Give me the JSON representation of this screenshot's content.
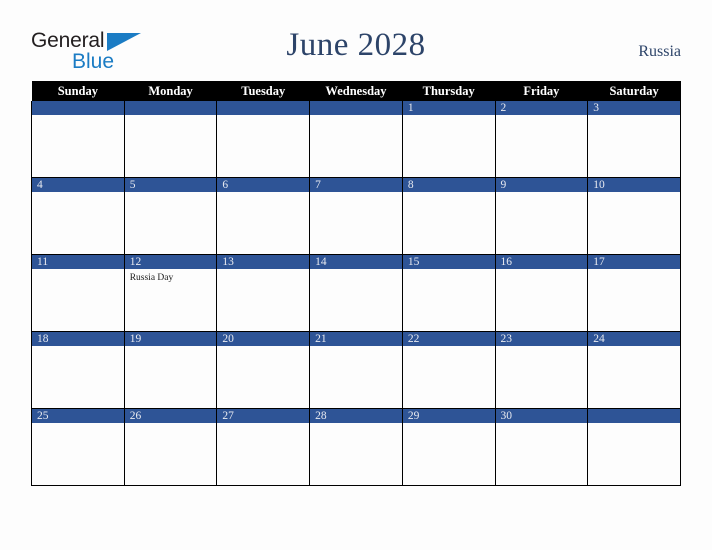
{
  "brand": {
    "name_part1": "General",
    "name_part2": "Blue",
    "triangle_icon": "triangle-icon",
    "color_dark": "#231f20",
    "color_blue": "#1b7cc4"
  },
  "header": {
    "title": "June 2028",
    "country": "Russia",
    "title_color": "#2d4469"
  },
  "theme": {
    "accent_blue": "#2e5496",
    "header_bg": "#000000",
    "page_bg": "#fdfdfd",
    "day_number_color": "#e8eaf0"
  },
  "calendar": {
    "month": "June",
    "year": "2028",
    "weekday_headers": [
      "Sunday",
      "Monday",
      "Tuesday",
      "Wednesday",
      "Thursday",
      "Friday",
      "Saturday"
    ],
    "weeks": [
      [
        {
          "day": "",
          "events": []
        },
        {
          "day": "",
          "events": []
        },
        {
          "day": "",
          "events": []
        },
        {
          "day": "",
          "events": []
        },
        {
          "day": "1",
          "events": []
        },
        {
          "day": "2",
          "events": []
        },
        {
          "day": "3",
          "events": []
        }
      ],
      [
        {
          "day": "4",
          "events": []
        },
        {
          "day": "5",
          "events": []
        },
        {
          "day": "6",
          "events": []
        },
        {
          "day": "7",
          "events": []
        },
        {
          "day": "8",
          "events": []
        },
        {
          "day": "9",
          "events": []
        },
        {
          "day": "10",
          "events": []
        }
      ],
      [
        {
          "day": "11",
          "events": []
        },
        {
          "day": "12",
          "events": [
            "Russia Day"
          ]
        },
        {
          "day": "13",
          "events": []
        },
        {
          "day": "14",
          "events": []
        },
        {
          "day": "15",
          "events": []
        },
        {
          "day": "16",
          "events": []
        },
        {
          "day": "17",
          "events": []
        }
      ],
      [
        {
          "day": "18",
          "events": []
        },
        {
          "day": "19",
          "events": []
        },
        {
          "day": "20",
          "events": []
        },
        {
          "day": "21",
          "events": []
        },
        {
          "day": "22",
          "events": []
        },
        {
          "day": "23",
          "events": []
        },
        {
          "day": "24",
          "events": []
        }
      ],
      [
        {
          "day": "25",
          "events": []
        },
        {
          "day": "26",
          "events": []
        },
        {
          "day": "27",
          "events": []
        },
        {
          "day": "28",
          "events": []
        },
        {
          "day": "29",
          "events": []
        },
        {
          "day": "30",
          "events": []
        },
        {
          "day": "",
          "events": []
        }
      ]
    ]
  }
}
